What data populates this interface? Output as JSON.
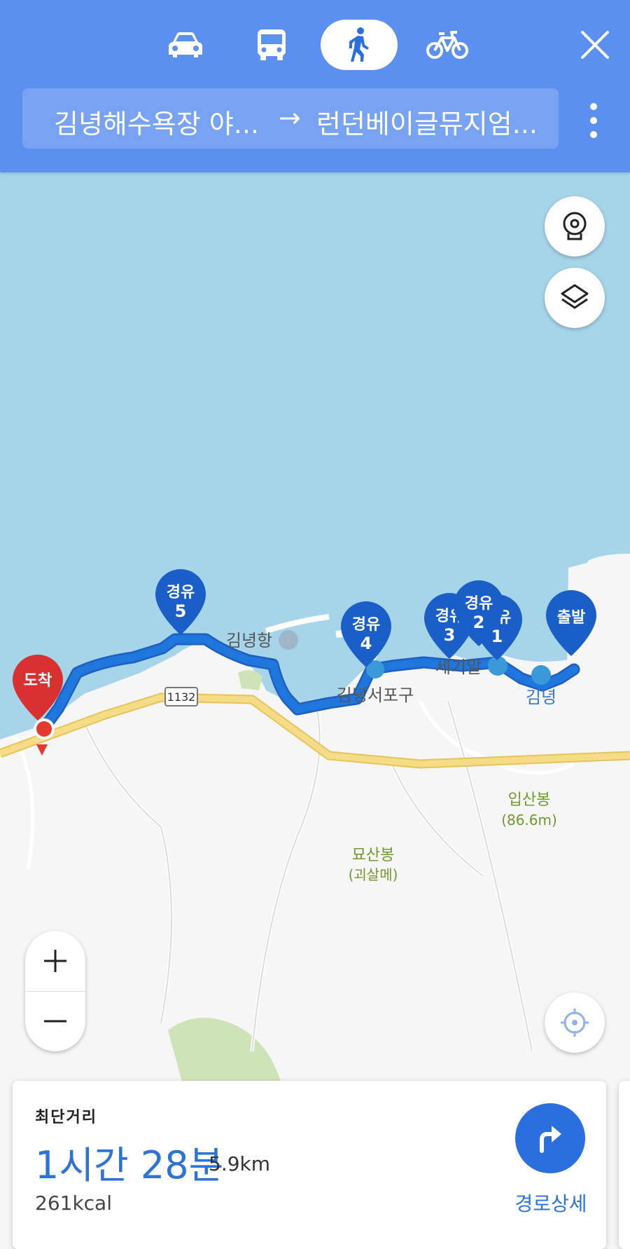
{
  "header": {
    "modes": [
      {
        "name": "car",
        "active": false
      },
      {
        "name": "bus",
        "active": false
      },
      {
        "name": "walk",
        "active": true
      },
      {
        "name": "bike",
        "active": false
      }
    ],
    "origin": "김녕해수욕장 야...",
    "arrow": "→",
    "destination": "런던베이글뮤지엄..."
  },
  "map": {
    "markers": {
      "start": "출발",
      "end": "도착",
      "waypoints": [
        {
          "label": "경유",
          "number": "1"
        },
        {
          "label": "경유",
          "number": "2"
        },
        {
          "label": "경유",
          "number": "3"
        },
        {
          "label": "경유",
          "number": "4"
        },
        {
          "label": "경유",
          "number": "5"
        }
      ]
    },
    "labels": {
      "port": "김녕항",
      "west_port": "김녕서포구",
      "segiol": "세기알",
      "gimnyeong": "김녕",
      "ipsanbong": "입산봉",
      "ipsanbong_height": "(86.6m)",
      "myosanbong": "묘산봉",
      "myosanbong_sub": "(괴살메)",
      "road_number": "1132"
    },
    "colors": {
      "sea": "#a6d5ea",
      "route": "#1f76dd",
      "road": "#f2d36f",
      "land": "#f6f6f6",
      "park": "#cfe3b8",
      "accent": "#5b8ff0",
      "end_marker": "#d93030"
    }
  },
  "summary": {
    "route_type": "최단거리",
    "duration": "1시간 28분",
    "distance": "5.9km",
    "calories": "261kcal",
    "detail_label": "경로상세"
  }
}
